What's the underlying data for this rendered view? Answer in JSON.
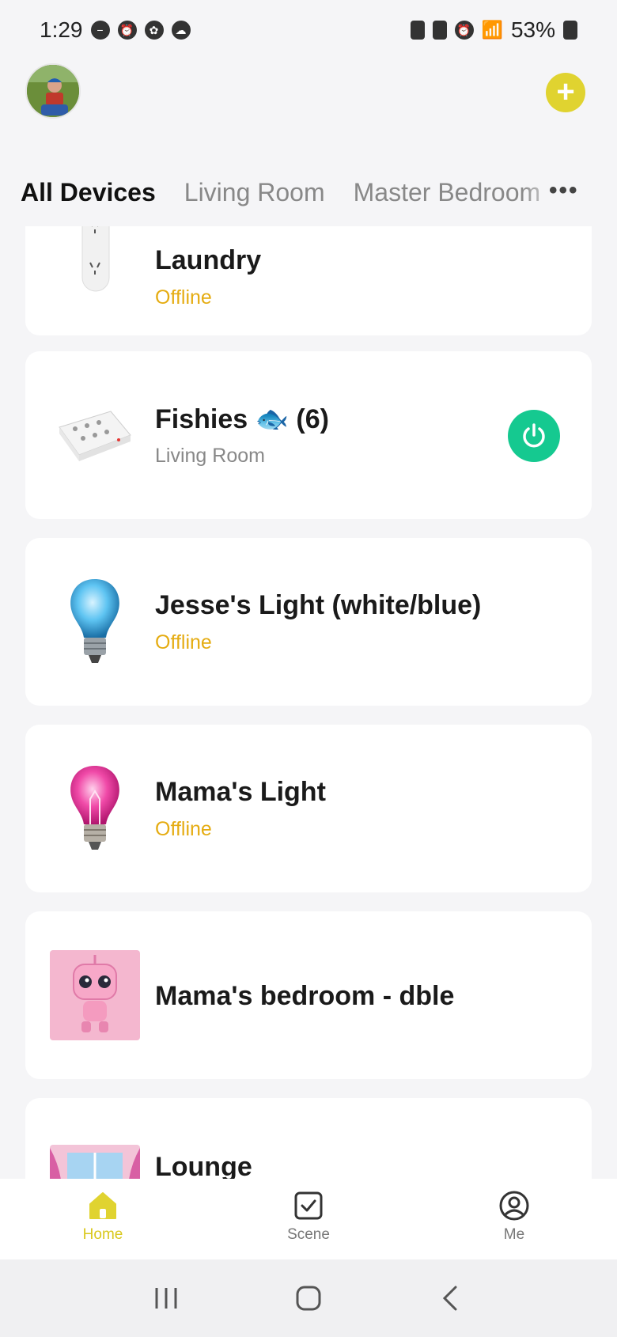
{
  "status_bar": {
    "time": "1:29",
    "battery": "53%"
  },
  "header": {
    "avatar_alt": "",
    "add_button_label": "+"
  },
  "tabs": [
    {
      "label": "All Devices",
      "active": true
    },
    {
      "label": "Living Room",
      "active": false
    },
    {
      "label": "Master Bedroom",
      "active": false
    }
  ],
  "tabs_more": "•••",
  "devices": [
    {
      "name": "Laundry",
      "sub": "Offline",
      "sub_type": "offline",
      "icon": "power-strip-vertical-icon"
    },
    {
      "name": "Fishies 🐟 (6)",
      "sub": "Living Room",
      "sub_type": "room",
      "icon": "power-strip-icon",
      "power": "on"
    },
    {
      "name": "Jesse's Light (white/blue)",
      "sub": "Offline",
      "sub_type": "offline",
      "icon": "blue-bulb-icon"
    },
    {
      "name": "Mama's Light",
      "sub": "Offline",
      "sub_type": "offline",
      "icon": "pink-bulb-icon"
    },
    {
      "name": "Mama's bedroom - dble",
      "sub": "",
      "sub_type": "",
      "icon": "pink-robot-image"
    },
    {
      "name": "Lounge",
      "sub": "",
      "sub_type": "",
      "icon": "lounge-window-image"
    }
  ],
  "bottom_nav": [
    {
      "label": "Home",
      "icon": "home-icon",
      "active": true
    },
    {
      "label": "Scene",
      "icon": "scene-check-icon",
      "active": false
    },
    {
      "label": "Me",
      "icon": "profile-icon",
      "active": false
    }
  ],
  "colors": {
    "accent": "#e0d330",
    "offline": "#e5ac12",
    "power_on": "#15c990"
  }
}
